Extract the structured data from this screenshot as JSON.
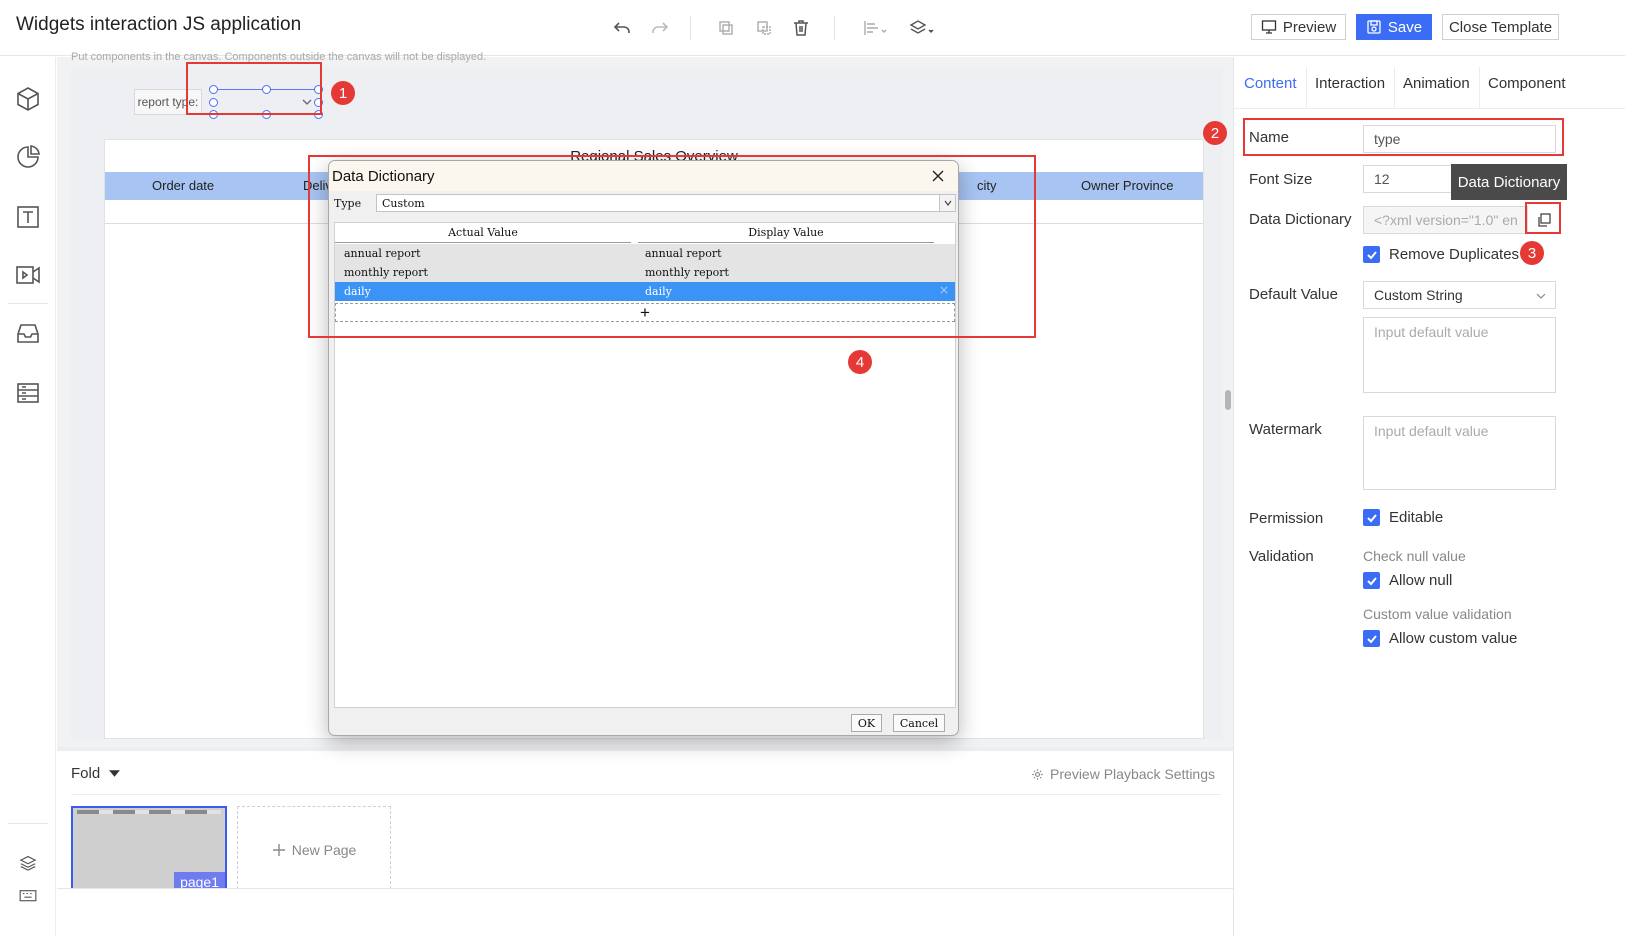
{
  "app": {
    "title": "Widgets interaction JS application"
  },
  "toolbar": {
    "preview_label": "Preview",
    "save_label": "Save",
    "close_template_label": "Close Template"
  },
  "canvas": {
    "hint": "Put components in the canvas. Components outside the canvas will not be displayed.",
    "report_type_label": "report type:",
    "report": {
      "title": "Regional Sales Overview",
      "columns": [
        "Order date",
        "Delivery",
        "city",
        "Owner Province"
      ]
    }
  },
  "pages": {
    "fold_label": "Fold",
    "preview_playback_label": "Preview Playback Settings",
    "page1_label": "page1",
    "new_page_label": "New Page"
  },
  "right_panel": {
    "tabs": [
      {
        "label": "Content",
        "active": true
      },
      {
        "label": "Interaction"
      },
      {
        "label": "Animation"
      },
      {
        "label": "Component"
      }
    ],
    "name": {
      "label": "Name",
      "value": "type"
    },
    "font_size": {
      "label": "Font Size",
      "value": "12"
    },
    "data_dictionary": {
      "label": "Data Dictionary",
      "value": "<?xml version=\"1.0\" en"
    },
    "remove_duplicates": {
      "label": "Remove Duplicates",
      "checked": true
    },
    "default_value": {
      "label": "Default Value",
      "select": "Custom String",
      "placeholder": "Input default value"
    },
    "watermark": {
      "label": "Watermark",
      "placeholder": "Input default value"
    },
    "permission": {
      "label": "Permission",
      "editable_label": "Editable"
    },
    "validation": {
      "label": "Validation",
      "check_null_heading": "Check null value",
      "allow_null_label": "Allow null",
      "custom_validation_heading": "Custom value validation",
      "allow_custom_label": "Allow custom value"
    },
    "tooltip": "Data Dictionary"
  },
  "dialog": {
    "title": "Data Dictionary",
    "type_label": "Type",
    "type_value": "Custom",
    "columns": [
      "Actual Value",
      "Display Value"
    ],
    "rows": [
      {
        "actual": "annual report",
        "display": "annual report"
      },
      {
        "actual": "monthly report",
        "display": "monthly report"
      },
      {
        "actual": "daily",
        "display": "daily",
        "selected": true
      }
    ],
    "add_symbol": "+",
    "ok_label": "OK",
    "cancel_label": "Cancel"
  },
  "annotations": [
    "1",
    "2",
    "3",
    "4"
  ],
  "colors": {
    "accent": "#3b6cf5",
    "annotation_red": "#e53935",
    "table_header": "#a7c4f2",
    "selected_row": "#3a93f5"
  }
}
